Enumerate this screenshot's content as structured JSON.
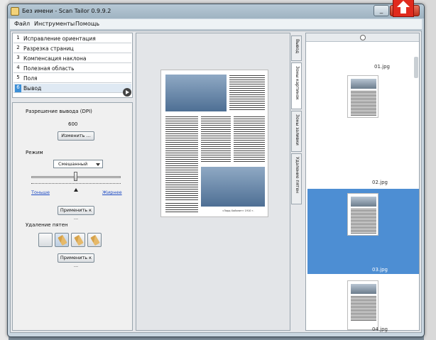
{
  "window": {
    "title": "Без имени - Scan Tailor 0.9.9.2",
    "min_glyph": "_",
    "close_glyph": "✕"
  },
  "menu": [
    "Файл",
    "Инструменты",
    "Помощь"
  ],
  "stages": [
    {
      "num": "1",
      "label": "Исправление ориентация"
    },
    {
      "num": "2",
      "label": "Разрезка страниц"
    },
    {
      "num": "3",
      "label": "Компенсация наклона"
    },
    {
      "num": "4",
      "label": "Полезная область"
    },
    {
      "num": "5",
      "label": "Поля"
    },
    {
      "num": "6",
      "label": "Вывод"
    }
  ],
  "options": {
    "dpi_label": "Разрешение вывода (DPI)",
    "dpi_value": "600",
    "change_button": "Изменить ...",
    "mode_label": "Режим",
    "mode_value": "Смешанный",
    "thinner_label": "Тоньше",
    "thicker_label": "Жирнее",
    "threshold_level": 0.5,
    "apply_button_1": "Применить к ...",
    "despeckle_label": "Удаление пятен",
    "apply_button_2": "Применить к ..."
  },
  "tabs": [
    "Вывод",
    "Зоны картинок",
    "Зоны заливки",
    "Удаление пятен"
  ],
  "page_caption": "«Лорд Хайсмит» 1910 г.",
  "thumbnails": [
    {
      "name": "01.jpg"
    },
    {
      "name": "02.jpg"
    },
    {
      "name": "03.jpg",
      "selected": true
    },
    {
      "name": "04.jpg"
    }
  ],
  "colors": {
    "selection": "#4d8ed3",
    "accent_red": "#e02a1e"
  }
}
